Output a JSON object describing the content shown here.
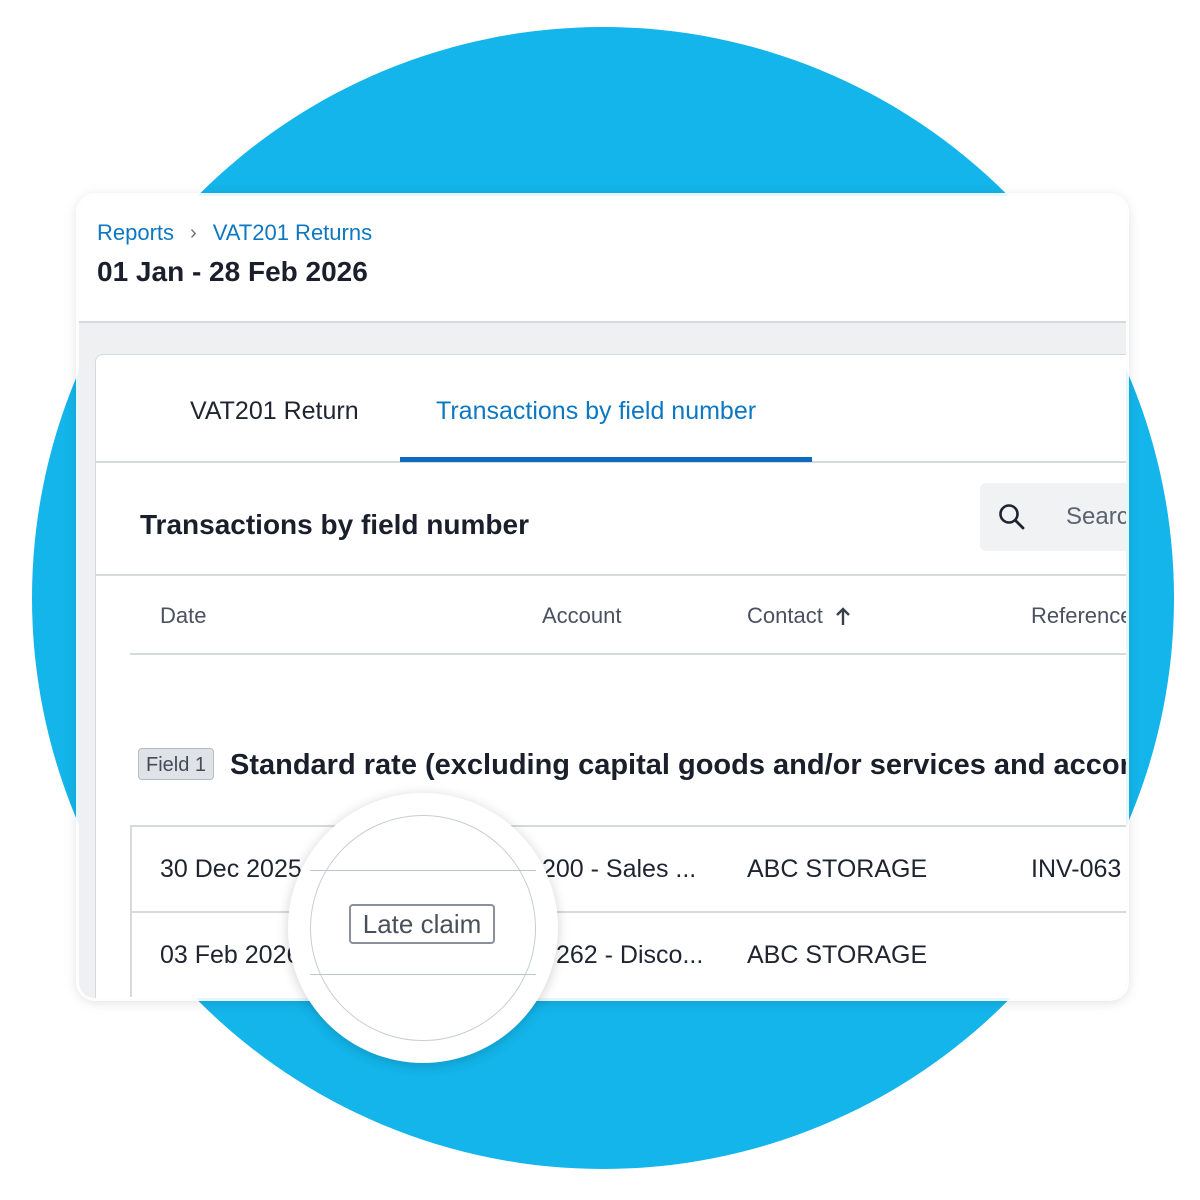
{
  "breadcrumb": {
    "items": [
      "Reports",
      "VAT201 Returns"
    ]
  },
  "page_title": "01 Jan - 28 Feb 2026",
  "tabs": [
    {
      "label": "VAT201 Return",
      "active": false
    },
    {
      "label": "Transactions by field number",
      "active": true
    }
  ],
  "section": {
    "title": "Transactions by field number"
  },
  "search": {
    "placeholder": "Search"
  },
  "table": {
    "columns": [
      "Date",
      "Account",
      "Contact",
      "Reference"
    ],
    "sort_column": "Contact",
    "sort_direction": "ascending"
  },
  "field_group": {
    "badge": "Field 1",
    "title": "Standard rate (excluding capital goods and/or services and accommodation)"
  },
  "rows": [
    {
      "date": "30 Dec 2025",
      "account": "200 - Sales ...",
      "contact": "ABC STORAGE",
      "reference": "INV-063"
    },
    {
      "date": "03 Feb 2026",
      "account": "262 - Disco...",
      "contact": "ABC STORAGE",
      "reference": ""
    }
  ],
  "magnifier": {
    "badge": "Late claim"
  },
  "colors": {
    "brand_circle": "#13b5ea",
    "link": "#0c78c2",
    "tab_underline": "#0c6bbd"
  }
}
